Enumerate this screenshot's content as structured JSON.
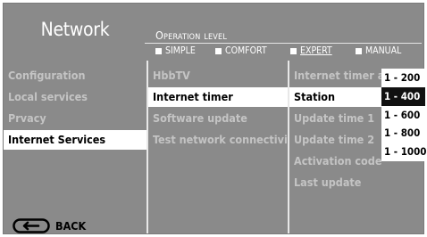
{
  "header": {
    "title": "Network",
    "operation_level_label": "Operation level",
    "modes": [
      {
        "label": "SIMPLE",
        "selected": false
      },
      {
        "label": "COMFORT",
        "selected": false
      },
      {
        "label": "EXPERT",
        "selected": true
      },
      {
        "label": "MANUAL",
        "selected": false
      }
    ]
  },
  "menu": {
    "items": [
      {
        "label": "Configuration",
        "state": "inactive"
      },
      {
        "label": "Local services",
        "state": "inactive"
      },
      {
        "label": "Prvacy",
        "state": "inactive"
      },
      {
        "label": "Internet Services",
        "state": "selected"
      }
    ]
  },
  "submenu": {
    "items": [
      {
        "label": "HbbTV",
        "state": "inactive"
      },
      {
        "label": "Internet timer",
        "state": "selected"
      },
      {
        "label": "Software update",
        "state": "inactive"
      },
      {
        "label": "Test network connectivity",
        "state": "inactive"
      }
    ]
  },
  "settings": {
    "items": [
      {
        "label": "Internet timer activity",
        "state": "inactive"
      },
      {
        "label": "Station",
        "state": "selected"
      },
      {
        "label": "Update time 1",
        "state": "inactive"
      },
      {
        "label": "Update time 2",
        "state": "inactive"
      },
      {
        "label": "Activation code",
        "state": "inactive"
      },
      {
        "label": "Last update",
        "state": "inactive"
      }
    ]
  },
  "dropdown": {
    "options": [
      "1 - 200",
      "1 - 400",
      "1 - 600",
      "1 - 800",
      "1 - 1000"
    ],
    "selected_index": 1
  },
  "footer": {
    "back_label": "BACK",
    "back_icon": "remote-back-icon"
  },
  "colors": {
    "panel_bg": "#8a8a8a",
    "selected_bg": "#ffffff",
    "dropdown_selected_bg": "#111111",
    "inactive_text": "#c4c4c4",
    "active_text": "#ffffff"
  }
}
